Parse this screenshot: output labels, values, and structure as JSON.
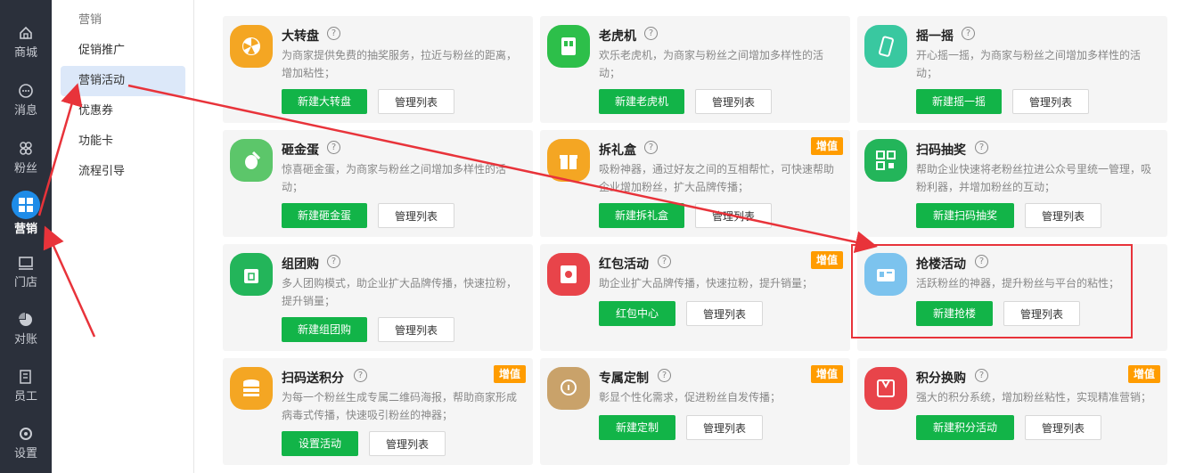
{
  "rail": {
    "items": [
      {
        "label": "商城",
        "icon": "shop-icon"
      },
      {
        "label": "消息",
        "icon": "message-icon"
      },
      {
        "label": "粉丝",
        "icon": "fans-icon"
      },
      {
        "label": "营销",
        "icon": "marketing-icon",
        "active": true
      },
      {
        "label": "门店",
        "icon": "store-icon"
      },
      {
        "label": "对账",
        "icon": "reconcile-icon"
      },
      {
        "label": "员工",
        "icon": "staff-icon"
      },
      {
        "label": "设置",
        "icon": "settings-icon"
      }
    ]
  },
  "submenu": {
    "header": "营销",
    "items": [
      "促销推广",
      "营销活动",
      "优惠券",
      "功能卡",
      "流程引导"
    ],
    "active": "营销活动"
  },
  "badge_label": "增值",
  "cards": [
    {
      "title": "大转盘",
      "desc": "为商家提供免费的抽奖服务，拉近与粉丝的距离，增加粘性；",
      "primary": "新建大转盘",
      "secondary": "管理列表",
      "color": "#f4a623",
      "icon": "wheel-icon"
    },
    {
      "title": "老虎机",
      "desc": "欢乐老虎机，为商家与粉丝之间增加多样性的活动；",
      "primary": "新建老虎机",
      "secondary": "管理列表",
      "color": "#2dbf4a",
      "icon": "slot-machine-icon"
    },
    {
      "title": "摇一摇",
      "desc": "开心摇一摇，为商家与粉丝之间增加多样性的活动；",
      "primary": "新建摇一摇",
      "secondary": "管理列表",
      "color": "#39c8a0",
      "icon": "phone-shake-icon"
    },
    {
      "title": "砸金蛋",
      "desc": "惊喜砸金蛋，为商家与粉丝之间增加多样性的活动；",
      "primary": "新建砸金蛋",
      "secondary": "管理列表",
      "color": "#5cc66a",
      "icon": "golden-egg-icon"
    },
    {
      "title": "拆礼盒",
      "desc": "吸粉神器，通过好友之间的互相帮忙，可快速帮助企业增加粉丝，扩大品牌传播；",
      "primary": "新建拆礼盒",
      "secondary": "管理列表",
      "badge": true,
      "color": "#f4a623",
      "icon": "gift-box-icon"
    },
    {
      "title": "扫码抽奖",
      "desc": "帮助企业快速将老粉丝拉进公众号里统一管理，吸粉利器，并增加粉丝的互动；",
      "primary": "新建扫码抽奖",
      "secondary": "管理列表",
      "color": "#23b55a",
      "icon": "qr-code-icon"
    },
    {
      "title": "组团购",
      "desc": "多人团购模式，助企业扩大品牌传播，快速拉粉，提升销量；",
      "primary": "新建组团购",
      "secondary": "管理列表",
      "color": "#23b55a",
      "icon": "shopping-bag-icon"
    },
    {
      "title": "红包活动",
      "desc": "助企业扩大品牌传播，快速拉粉，提升销量；",
      "primary": "红包中心",
      "secondary": "管理列表",
      "badge": true,
      "color": "#e8444a",
      "icon": "red-envelope-icon"
    },
    {
      "title": "抢楼活动",
      "desc": "活跃粉丝的神器，提升粉丝与平台的粘性；",
      "primary": "新建抢楼",
      "secondary": "管理列表",
      "color": "#7cc3ee",
      "icon": "building-icon"
    },
    {
      "title": "扫码送积分",
      "desc": "为每一个粉丝生成专属二维码海报，帮助商家形成病毒式传播，快速吸引粉丝的神器；",
      "primary": "设置活动",
      "secondary": "管理列表",
      "badge": true,
      "color": "#f4a623",
      "icon": "coin-stack-icon"
    },
    {
      "title": "专属定制",
      "desc": "彰显个性化需求，促进粉丝自发传播；",
      "primary": "新建定制",
      "secondary": "管理列表",
      "badge": true,
      "color": "#c9a26a",
      "icon": "bulb-icon"
    },
    {
      "title": "积分换购",
      "desc": "强大的积分系统，增加粉丝粘性，实现精准营销；",
      "primary": "新建积分活动",
      "secondary": "管理列表",
      "badge": true,
      "color": "#e8444a",
      "icon": "points-bag-icon"
    }
  ]
}
